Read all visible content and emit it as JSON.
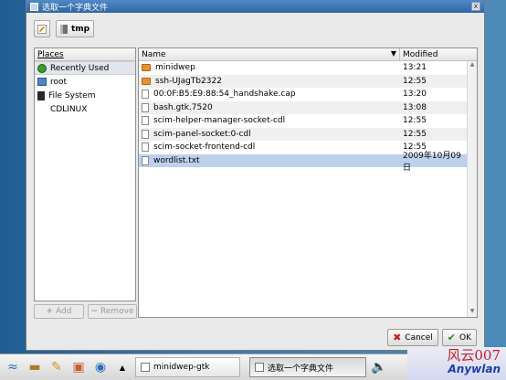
{
  "dialog": {
    "title": "选取一个字典文件",
    "close_glyph": "x"
  },
  "toolbar": {
    "path_button_label": "tmp"
  },
  "places": {
    "header": "Places",
    "items": [
      {
        "label": "Recently Used",
        "icon": "clock-icon"
      },
      {
        "label": "root",
        "icon": "home-icon"
      },
      {
        "label": "File System",
        "icon": "drive-icon"
      },
      {
        "label": "CDLINUX",
        "icon": "none"
      }
    ],
    "add_label": "Add",
    "remove_label": "Remove"
  },
  "files": {
    "name_header": "Name",
    "modified_header": "Modified",
    "rows": [
      {
        "name": "minidwep",
        "modified": "13:21",
        "type": "folder"
      },
      {
        "name": "ssh-UJagTb2322",
        "modified": "12:55",
        "type": "folder"
      },
      {
        "name": "00:0F:B5:E9:88:54_handshake.cap",
        "modified": "13:20",
        "type": "file"
      },
      {
        "name": "bash.gtk.7520",
        "modified": "13:08",
        "type": "file"
      },
      {
        "name": "scim-helper-manager-socket-cdl",
        "modified": "12:55",
        "type": "file"
      },
      {
        "name": "scim-panel-socket:0-cdl",
        "modified": "12:55",
        "type": "file"
      },
      {
        "name": "scim-socket-frontend-cdl",
        "modified": "12:55",
        "type": "file"
      },
      {
        "name": "wordlist.txt",
        "modified": "2009年10月09日",
        "type": "file",
        "selected": true
      }
    ]
  },
  "buttons": {
    "cancel": "Cancel",
    "ok": "OK"
  },
  "taskbar": {
    "task1": "minidwep-gtk",
    "task2": "选取一个字典文件"
  },
  "watermark": {
    "line1": "风云007",
    "line2": "Anywlan"
  }
}
